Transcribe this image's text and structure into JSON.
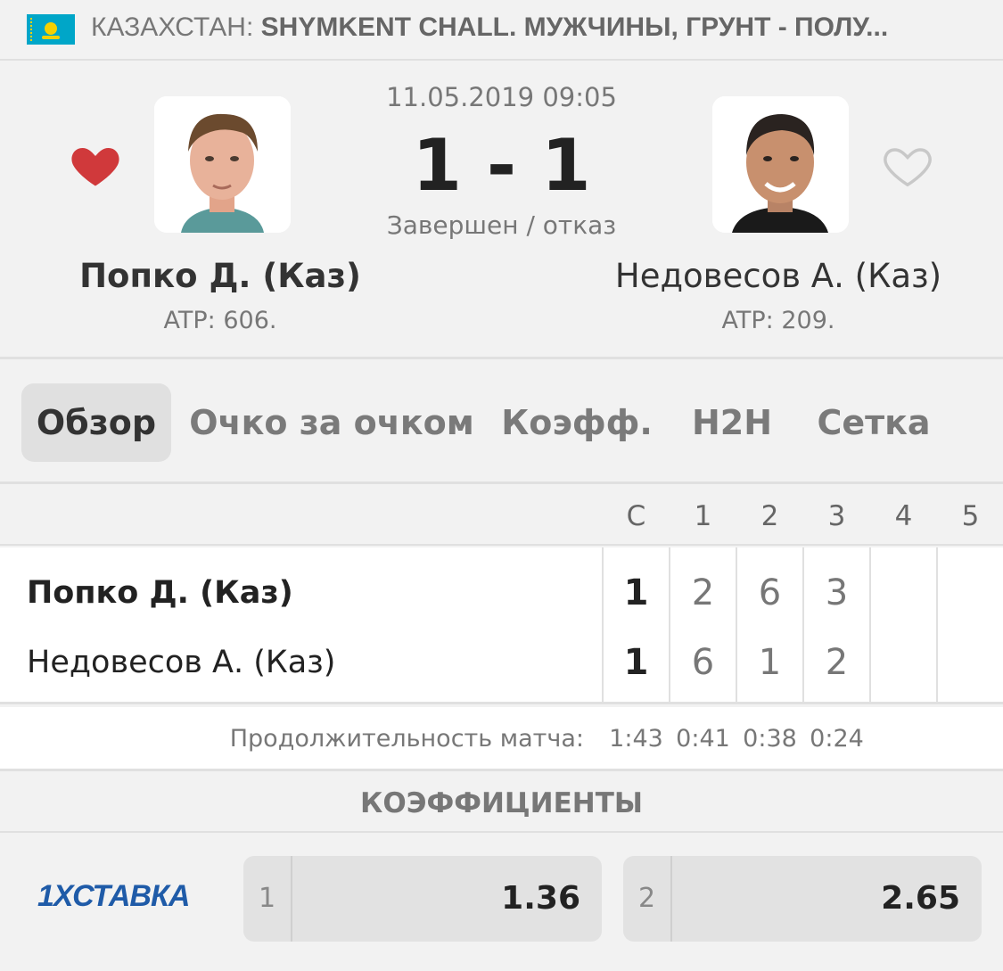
{
  "header": {
    "country": "КАЗАХСТАН:",
    "tournament": "SHYMKENT CHALL. МУЖЧИНЫ, ГРУНТ - ПОЛУ..."
  },
  "match": {
    "datetime": "11.05.2019 09:05",
    "score": "1 - 1",
    "status": "Завершен / отказ",
    "player1": {
      "name": "Попко Д. (Каз)",
      "rank": "ATP: 606.",
      "favorite": true
    },
    "player2": {
      "name": "Недовесов А. (Каз)",
      "rank": "ATP: 209.",
      "favorite": false
    }
  },
  "tabs": [
    "Обзор",
    "Очко за очком",
    "Коэфф.",
    "H2H",
    "Сетка"
  ],
  "table": {
    "columns": [
      "С",
      "1",
      "2",
      "3",
      "4",
      "5"
    ],
    "rows": [
      {
        "name": "Попко Д. (Каз)",
        "total": "1",
        "sets": [
          "2",
          "6",
          "3",
          "",
          ""
        ]
      },
      {
        "name": "Недовесов А. (Каз)",
        "total": "1",
        "sets": [
          "6",
          "1",
          "2",
          "",
          ""
        ]
      }
    ],
    "duration_label": "Продолжительность матча:",
    "durations": [
      "1:43",
      "0:41",
      "0:38",
      "0:24"
    ]
  },
  "odds": {
    "title": "КОЭФФИЦИЕНТЫ",
    "bookmaker": "1ХСТАВКА",
    "items": [
      {
        "label": "1",
        "value": "1.36"
      },
      {
        "label": "2",
        "value": "2.65"
      }
    ]
  },
  "colors": {
    "accent_heart": "#d0393b",
    "bookmaker_blue": "#1f5ba8"
  }
}
